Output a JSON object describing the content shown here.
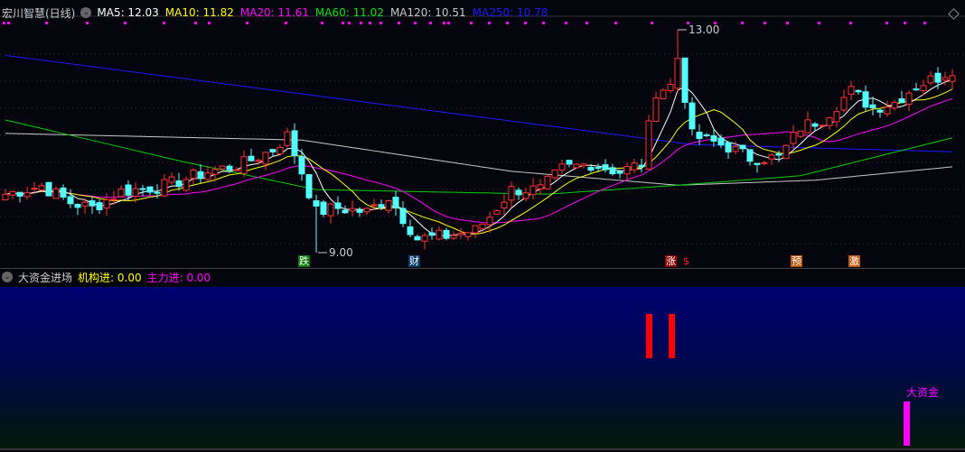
{
  "header": {
    "title": "宏川智慧(日线)",
    "ma": [
      {
        "label": "MA5: 12.03",
        "color": "#ffffff"
      },
      {
        "label": "MA10: 11.82",
        "color": "#ffff00"
      },
      {
        "label": "MA20: 11.61",
        "color": "#ff00ff"
      },
      {
        "label": "MA60: 11.02",
        "color": "#00e000"
      },
      {
        "label": "MA120: 10.51",
        "color": "#c8c8c8"
      },
      {
        "label": "MA250: 10.78",
        "color": "#1a1aff"
      }
    ]
  },
  "annotations": {
    "high": "13.00",
    "low": "9.00"
  },
  "signals": [
    {
      "text": "跌",
      "bg": "#0a7a0a",
      "color": "#ffffff"
    },
    {
      "text": "财",
      "bg": "#0a3a6a",
      "color": "#ffffff"
    },
    {
      "text": "涨",
      "bg": "#8a0000",
      "color": "#ffffff"
    },
    {
      "text": "$",
      "bg": "transparent",
      "color": "#ff2020"
    },
    {
      "text": "预",
      "bg": "#c05a10",
      "color": "#ffffff"
    },
    {
      "text": "激",
      "bg": "#c05a10",
      "color": "#ffffff"
    }
  ],
  "lower": {
    "title": "大资金进场",
    "inst_label": "机构进: 0.00",
    "main_label": "主力进: 0.00",
    "big_money_label": "大资金"
  },
  "colors": {
    "up": "#ff3030",
    "down": "#54ffff",
    "bg": "#05050d"
  },
  "chart_data": {
    "type": "candlestick",
    "y_range": [
      9.0,
      13.0
    ],
    "close_path": [
      [
        0,
        10.05
      ],
      [
        5,
        10.2
      ],
      [
        9,
        9.9
      ],
      [
        12,
        9.8
      ],
      [
        16,
        10.1
      ],
      [
        22,
        10.2
      ],
      [
        28,
        10.45
      ],
      [
        33,
        10.6
      ],
      [
        37,
        10.85
      ],
      [
        39,
        11.1
      ],
      [
        41,
        10.45
      ],
      [
        43,
        9.73
      ],
      [
        46,
        9.8
      ],
      [
        50,
        9.73
      ],
      [
        53,
        10.0
      ],
      [
        57,
        9.25
      ],
      [
        61,
        9.3
      ],
      [
        65,
        9.4
      ],
      [
        67,
        9.65
      ],
      [
        70,
        10.13
      ],
      [
        74,
        10.13
      ],
      [
        77,
        10.5
      ],
      [
        81,
        10.6
      ],
      [
        85,
        10.45
      ],
      [
        88,
        10.6
      ],
      [
        90,
        11.9
      ],
      [
        92,
        12.0
      ],
      [
        93,
        12.5
      ],
      [
        95,
        11.1
      ],
      [
        100,
        10.9
      ],
      [
        103,
        10.7
      ],
      [
        107,
        10.7
      ],
      [
        110,
        11.25
      ],
      [
        113,
        11.4
      ],
      [
        117,
        11.9
      ],
      [
        120,
        11.6
      ],
      [
        123,
        11.7
      ],
      [
        126,
        12.0
      ],
      [
        129,
        12.15
      ],
      [
        131,
        12.3
      ]
    ],
    "ma60_path": [
      [
        0,
        11.38
      ],
      [
        25,
        10.62
      ],
      [
        43,
        10.13
      ],
      [
        75,
        10.05
      ],
      [
        93,
        10.21
      ],
      [
        110,
        10.38
      ],
      [
        131,
        11.06
      ]
    ],
    "ma120_path": [
      [
        0,
        11.14
      ],
      [
        41,
        11.02
      ],
      [
        70,
        10.46
      ],
      [
        93,
        10.21
      ],
      [
        112,
        10.3
      ],
      [
        131,
        10.54
      ]
    ],
    "ma250_path": [
      [
        0,
        12.54
      ],
      [
        95,
        10.94
      ],
      [
        131,
        10.81
      ]
    ]
  }
}
